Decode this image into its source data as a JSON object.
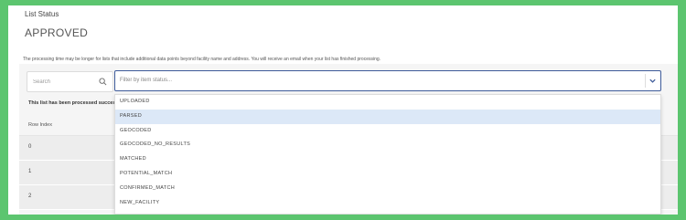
{
  "header": {
    "list_status_label": "List Status",
    "status_value": "APPROVED"
  },
  "notice": "The processing time may be longer for lists that include additional data points beyond facility name and address. You will receive an email when your list has finished processing.",
  "search": {
    "placeholder": "Search",
    "icon": "search-icon"
  },
  "filter": {
    "placeholder": "Filter by item status...",
    "icon": "chevron-down-icon",
    "options": [
      "UPLOADED",
      "PARSED",
      "GEOCODED",
      "GEOCODED_NO_RESULTS",
      "MATCHED",
      "POTENTIAL_MATCH",
      "CONFIRMED_MATCH",
      "NEW_FACILITY"
    ],
    "highlighted_option": "PARSED"
  },
  "processed_message": "This list has been processed successfu",
  "table": {
    "columns": [
      "Row Index"
    ],
    "rows": [
      [
        "0"
      ],
      [
        "1"
      ],
      [
        "2"
      ]
    ]
  },
  "colors": {
    "frame": "#5cc56f",
    "select_border": "#3d5a99",
    "highlight": "#dce8f7"
  }
}
